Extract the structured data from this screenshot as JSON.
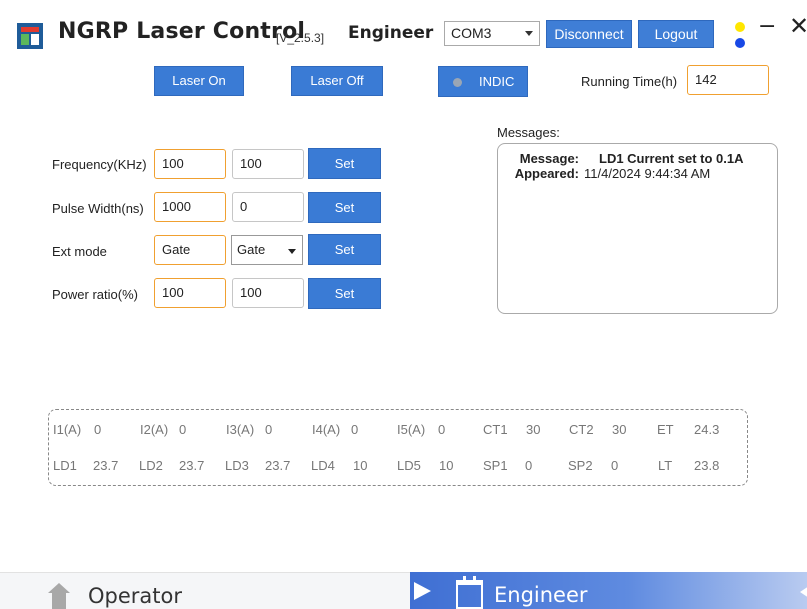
{
  "titlebar": {
    "app_title": "NGRP Laser Control",
    "version": "[V_2.5.3]",
    "role": "Engineer",
    "com_port": "COM3",
    "disconnect_label": "Disconnect",
    "logout_label": "Logout",
    "minimize_glyph": "−",
    "close_glyph": "✕",
    "status_dot_colors": [
      "#ffe600",
      "#1848e6"
    ]
  },
  "controls": {
    "laser_on_label": "Laser On",
    "laser_off_label": "Laser Off",
    "indic_label": "INDIC",
    "running_time_label": "Running Time(h)",
    "running_time_value": "142"
  },
  "params": [
    {
      "label": "Frequency(KHz)",
      "value": "100",
      "readback": "100",
      "set_label": "Set"
    },
    {
      "label": "Pulse Width(ns)",
      "value": "1000",
      "readback": "0",
      "set_label": "Set"
    },
    {
      "label": "Ext mode",
      "value": "Gate",
      "readback": "Gate",
      "set_label": "Set"
    },
    {
      "label": "Power ratio(%)",
      "value": "100",
      "readback": "100",
      "set_label": "Set"
    }
  ],
  "messages": {
    "label": "Messages:",
    "message_key": "Message:",
    "message_value": "LD1 Current set to 0.1A",
    "appeared_key": "Appeared:",
    "appeared_value": "11/4/2024 9:44:34 AM"
  },
  "status": {
    "row1": [
      {
        "name": "I1(A)",
        "value": "0"
      },
      {
        "name": "I2(A)",
        "value": "0"
      },
      {
        "name": "I3(A)",
        "value": "0"
      },
      {
        "name": "I4(A)",
        "value": "0"
      },
      {
        "name": "I5(A)",
        "value": "0"
      },
      {
        "name": "CT1",
        "value": "30"
      },
      {
        "name": "CT2",
        "value": "30"
      },
      {
        "name": "ET",
        "value": "24.3"
      }
    ],
    "row2": [
      {
        "name": "LD1",
        "value": "23.7"
      },
      {
        "name": "LD2",
        "value": "23.7"
      },
      {
        "name": "LD3",
        "value": "23.7"
      },
      {
        "name": "LD4",
        "value": "10"
      },
      {
        "name": "LD5",
        "value": "10"
      },
      {
        "name": "SP1",
        "value": "0"
      },
      {
        "name": "SP2",
        "value": "0"
      },
      {
        "name": "LT",
        "value": "23.8"
      }
    ]
  },
  "bottom_nav": {
    "operator_label": "Operator",
    "engineer_label": "Engineer",
    "operator_icon": "house-icon",
    "engineer_icon": "calendar-icon",
    "active": "Engineer"
  },
  "colors": {
    "button_blue": "#3a7bd5",
    "input_focus_orange": "#f0a030",
    "active_tab_blue": "#3f6fd3"
  }
}
